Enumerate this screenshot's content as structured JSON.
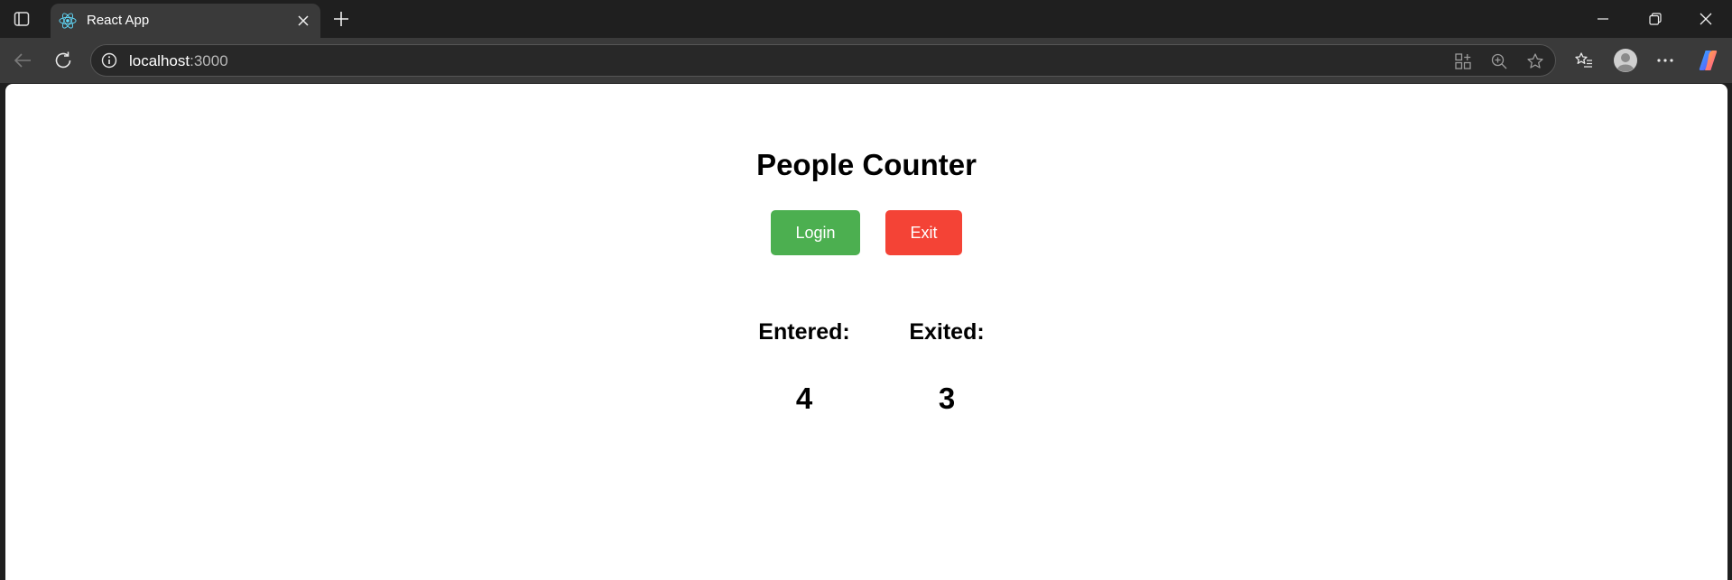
{
  "browser": {
    "tab": {
      "title": "React App"
    },
    "address_bar": {
      "host": "localhost",
      "port": ":3000"
    }
  },
  "app": {
    "title": "People Counter",
    "buttons": {
      "login_label": "Login",
      "exit_label": "Exit"
    },
    "stats": {
      "entered_label": "Entered:",
      "entered_value": "4",
      "exited_label": "Exited:",
      "exited_value": "3"
    }
  },
  "colors": {
    "login_button": "#4caf50",
    "exit_button": "#f44336",
    "browser_frame": "#1f1f1f",
    "toolbar": "#3a3a3a"
  },
  "icons": [
    "tab-actions-icon",
    "react-logo-icon",
    "close-icon",
    "plus-icon",
    "minimize-icon",
    "restore-icon",
    "back-arrow-icon",
    "refresh-icon",
    "info-icon",
    "app-available-icon",
    "zoom-icon",
    "star-icon",
    "favorites-icon",
    "profile-avatar-icon",
    "more-icon",
    "copilot-icon"
  ]
}
